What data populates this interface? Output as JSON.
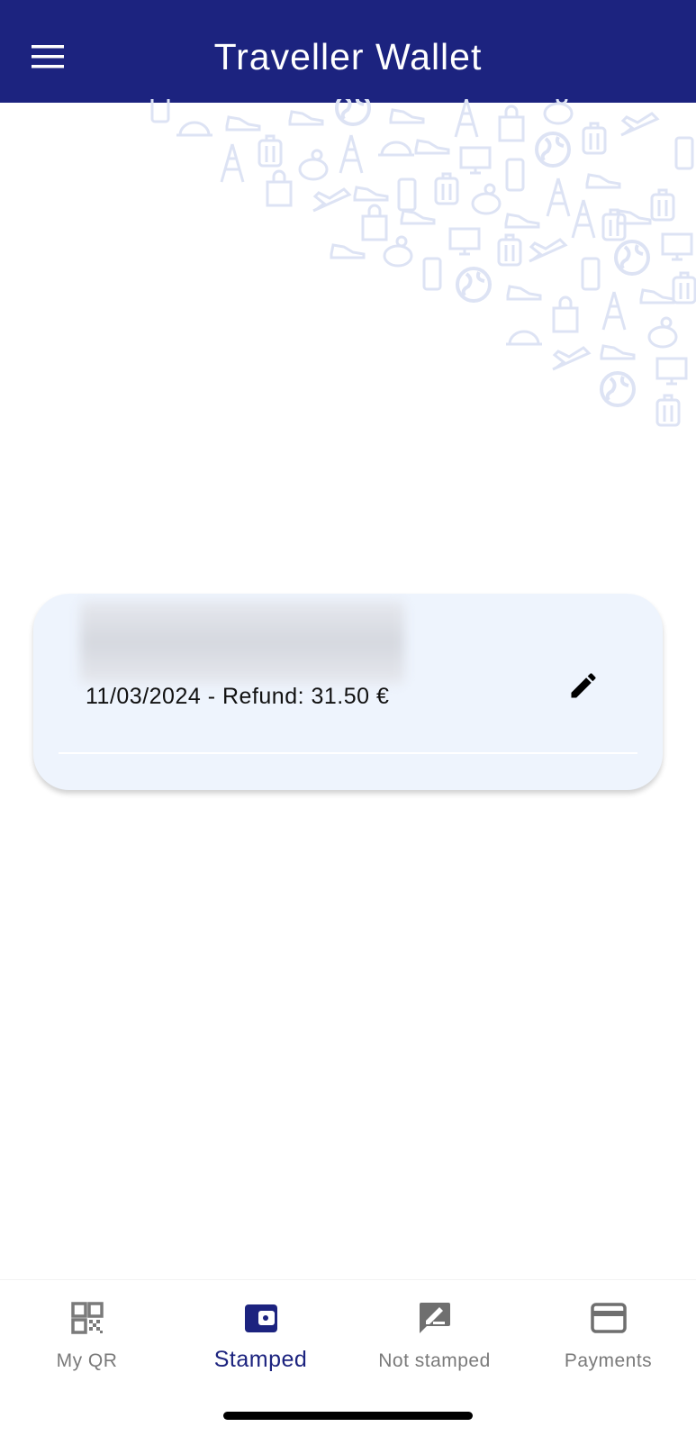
{
  "colors": {
    "primary": "#1c237f",
    "card_bg": "#eef4fd",
    "pattern": "#dde3f4",
    "nav_inactive": "#7a7a7a"
  },
  "header": {
    "title": "Traveller Wallet",
    "menu_icon": "hamburger-menu-icon"
  },
  "card": {
    "summary": "11/03/2024 - Refund: 31.50 €",
    "edit_icon": "pencil-icon"
  },
  "bottom_nav": {
    "selected": "Stamped",
    "items": [
      {
        "label": "My QR",
        "icon": "qr-code-icon"
      },
      {
        "label": "Stamped",
        "icon": "wallet-icon"
      },
      {
        "label": "Not stamped",
        "icon": "signature-icon"
      },
      {
        "label": "Payments",
        "icon": "credit-card-icon"
      }
    ]
  }
}
